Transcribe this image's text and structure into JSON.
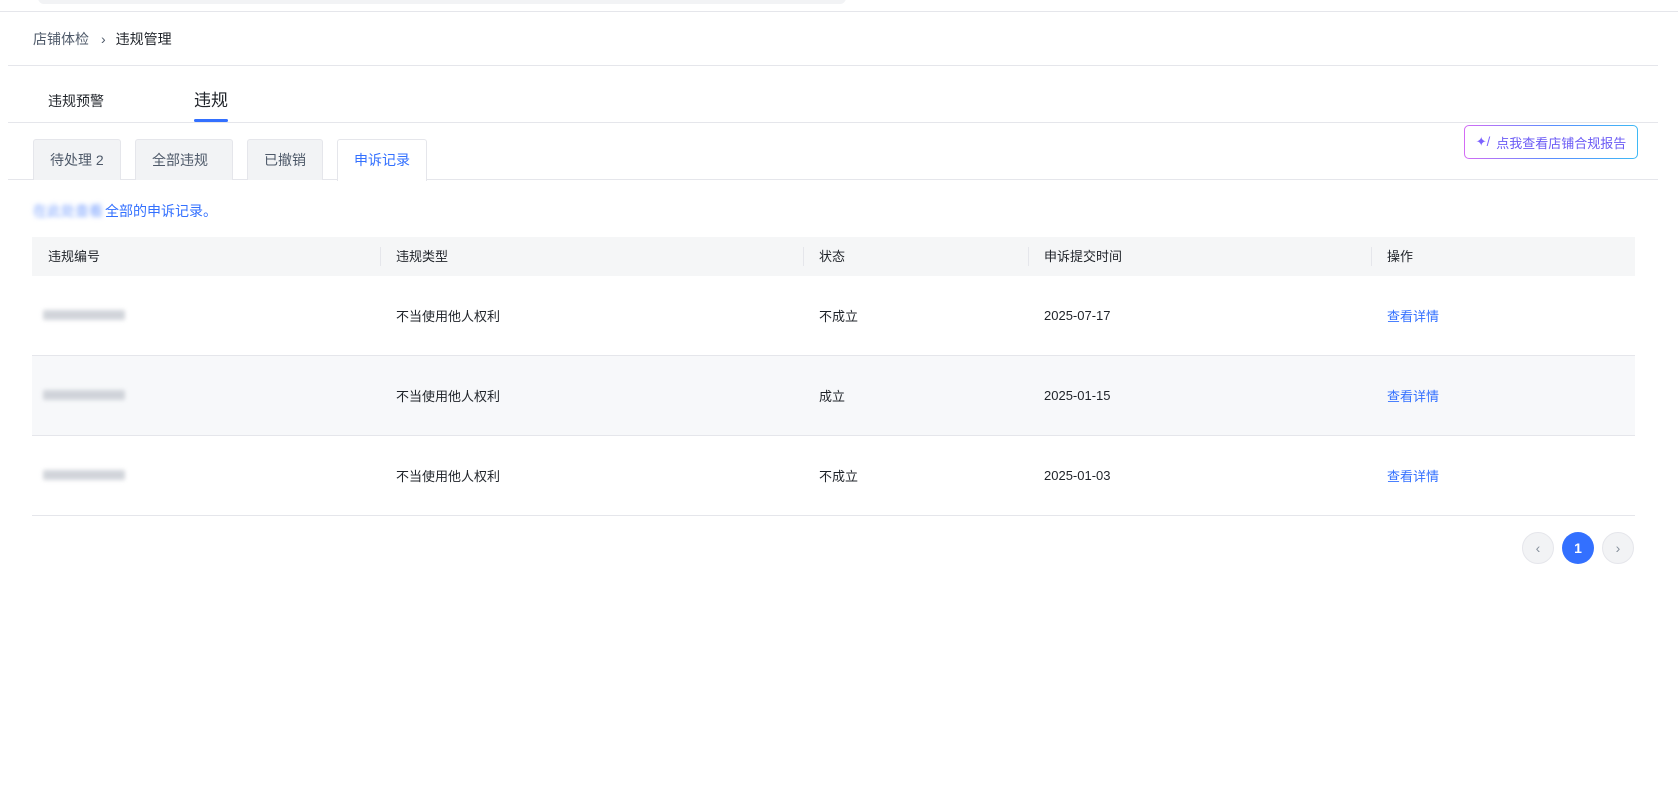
{
  "breadcrumb": {
    "parent": "店铺体检",
    "separator": "›",
    "current": "违规管理"
  },
  "main_tabs": [
    {
      "label": "违规预警",
      "active": false
    },
    {
      "label": "违规",
      "active": true
    }
  ],
  "sub_tabs": [
    {
      "label": "待处理 2",
      "active": false
    },
    {
      "label": "全部违规",
      "active": false
    },
    {
      "label": "已撤销",
      "active": false
    },
    {
      "label": "申诉记录",
      "active": true
    }
  ],
  "report_button": {
    "icon": "sparkle-icon",
    "icon_glyph": "✦/",
    "label": "点我查看店铺合规报告"
  },
  "notice": {
    "blurred_prefix": "在此处查看",
    "text": "全部的申诉记录。"
  },
  "table": {
    "headers": [
      "违规编号",
      "违规类型",
      "状态",
      "申诉提交时间",
      "操作"
    ],
    "rows": [
      {
        "type": "不当使用他人权利",
        "status": "不成立",
        "date": "2025-07-17",
        "action": "查看详情"
      },
      {
        "type": "不当使用他人权利",
        "status": "成立",
        "date": "2025-01-15",
        "action": "查看详情"
      },
      {
        "type": "不当使用他人权利",
        "status": "不成立",
        "date": "2025-01-03",
        "action": "查看详情"
      }
    ]
  },
  "pagination": {
    "prev_icon": "chevron-left-icon",
    "prev_glyph": "‹",
    "current_page": "1",
    "next_icon": "chevron-right-icon",
    "next_glyph": "›"
  },
  "colors": {
    "accent": "#3370ff",
    "header_bg": "#f5f6f7",
    "alt_row_bg": "#f7f8fa"
  }
}
